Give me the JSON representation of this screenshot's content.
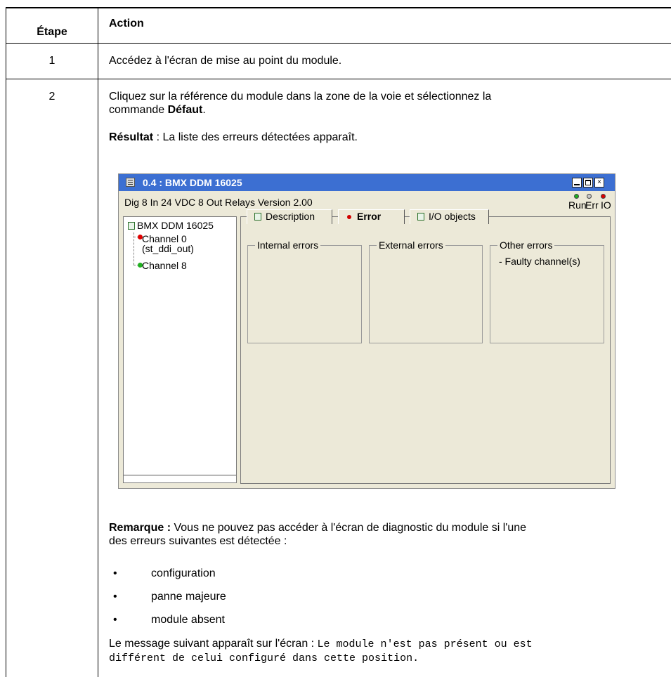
{
  "table": {
    "header_step": "Étape",
    "header_action": "Action"
  },
  "row1": {
    "step": "1",
    "text": "Accédez à l'écran de mise au point du module."
  },
  "row2": {
    "step": "2",
    "line1": "Cliquez sur la référence du module dans la zone de la voie et sélectionnez la",
    "line2_prefix": "commande ",
    "line2_bold": "Défaut",
    "line2_suffix": ".",
    "result_label": "Résultat",
    "result_text": " : La liste des erreurs détectées apparaît.",
    "note_label": "Remarque :",
    "note_text1": " Vous ne pouvez pas accéder à l'écran de diagnostic du module si l'une",
    "note_text2": "des erreurs suivantes est détectée :",
    "bullets": [
      "configuration",
      "panne majeure",
      "module absent"
    ],
    "bullet_char": "•",
    "message_prefix": "Le message suivant apparaît sur l'écran : ",
    "message_code1": "Le module n'est pas présent ou est",
    "message_code2": "différent de celui configuré dans cette position."
  },
  "window": {
    "title": "0.4 : BMX DDM 16025",
    "subtitle": "Dig 8 In 24 VDC 8 Out Relays Version 2.00",
    "leds": [
      {
        "label": "Run",
        "color": "#20b020"
      },
      {
        "label": "Err",
        "color": "#c8c8c8"
      },
      {
        "label": "IO",
        "color": "#e00000"
      }
    ],
    "close_glyph": "×",
    "tree": {
      "root": "BMX DDM 16025",
      "channel0_line1": "Channel 0",
      "channel0_line2": "(st_ddi_out)",
      "channel8": "Channel 8",
      "channel0_color": "#e00000",
      "channel8_color": "#20b020"
    },
    "tabs": {
      "description": "Description",
      "error": "Error",
      "io_objects": "I/O objects"
    },
    "groups": {
      "internal": "Internal errors",
      "external": "External errors",
      "other": "Other errors",
      "other_item": "- Faulty channel(s)"
    }
  }
}
